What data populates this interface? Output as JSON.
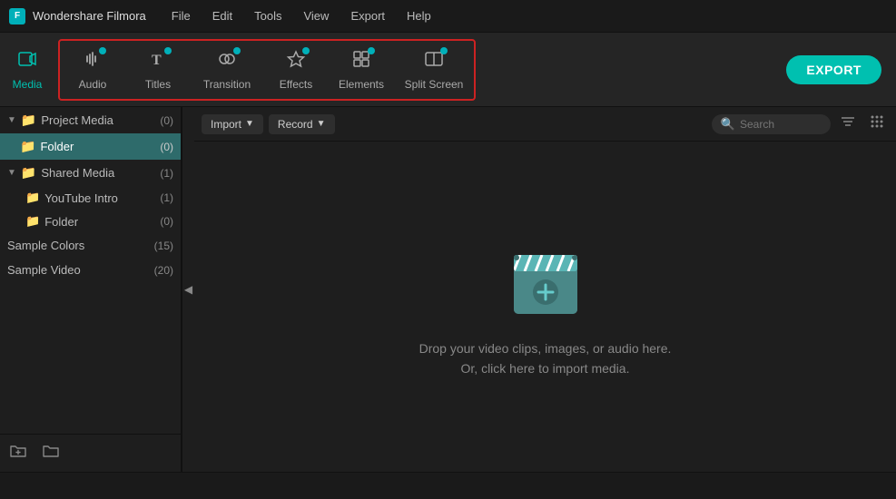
{
  "app": {
    "name": "Wondershare Filmora",
    "logo_text": "F"
  },
  "menubar": {
    "items": [
      "File",
      "Edit",
      "Tools",
      "View",
      "Export",
      "Help"
    ]
  },
  "toolbar": {
    "media_label": "Media",
    "audio_label": "Audio",
    "titles_label": "Titles",
    "transition_label": "Transition",
    "effects_label": "Effects",
    "elements_label": "Elements",
    "split_screen_label": "Split Screen",
    "export_label": "EXPORT"
  },
  "secondary_toolbar": {
    "import_label": "Import",
    "record_label": "Record",
    "search_placeholder": "Search"
  },
  "sidebar": {
    "project_media": {
      "label": "Project Media",
      "count": "(0)"
    },
    "folder_selected": {
      "label": "Folder",
      "count": "(0)"
    },
    "shared_media": {
      "label": "Shared Media",
      "count": "(1)"
    },
    "youtube_intro": {
      "label": "YouTube Intro",
      "count": "(1)"
    },
    "shared_folder": {
      "label": "Folder",
      "count": "(0)"
    },
    "sample_colors": {
      "label": "Sample Colors",
      "count": "(15)"
    },
    "sample_video": {
      "label": "Sample Video",
      "count": "(20)"
    }
  },
  "drop_zone": {
    "line1": "Drop your video clips, images, or audio here.",
    "line2": "Or, click here to import media."
  },
  "colors": {
    "accent": "#00c0b0",
    "selected_bg": "#2e6b6b",
    "outline_red": "#cc2222"
  }
}
